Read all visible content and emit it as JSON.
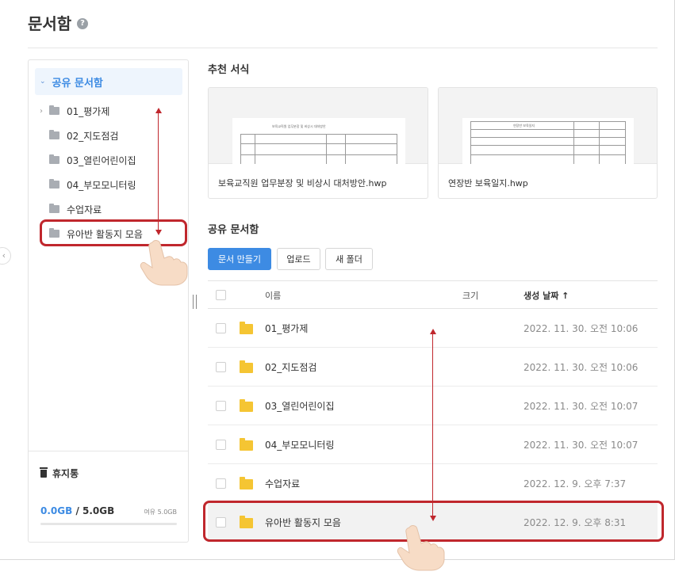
{
  "page": {
    "title": "문서함",
    "help_icon": "question-circle-icon"
  },
  "sidebar": {
    "root_label": "공유 문서함",
    "items": [
      {
        "label": "01_평가제",
        "has_children": true
      },
      {
        "label": "02_지도점검",
        "has_children": false
      },
      {
        "label": "03_열린어린이집",
        "has_children": false
      },
      {
        "label": "04_부모모니터링",
        "has_children": false
      },
      {
        "label": "수업자료",
        "has_children": false
      },
      {
        "label": "유아반 활동지 모음",
        "has_children": false
      }
    ],
    "trash_label": "휴지통",
    "quota_used": "0.0GB",
    "quota_total": " / 5.0GB",
    "quota_free": "여유 5.0GB",
    "quota_fraction": 0.0
  },
  "templates": {
    "section_title": "추천 서식",
    "cards": [
      {
        "name": "보육교직원 업무분장 및 비상시 대처방안.hwp",
        "preview_heading": "보육교직원 업무분장 및 비상시 대처방안"
      },
      {
        "name": "연장반 보육일지.hwp",
        "preview_heading": "연장반 보육일지"
      }
    ]
  },
  "shared": {
    "section_title": "공유 문서함",
    "buttons": {
      "create": "문서 만들기",
      "upload": "업로드",
      "new_folder": "새 폴더"
    },
    "columns": {
      "name": "이름",
      "size": "크기",
      "created": "생성 날짜 ↑"
    },
    "rows": [
      {
        "name": "01_평가제",
        "size": "",
        "created": "2022. 11. 30. 오전 10:06"
      },
      {
        "name": "02_지도점검",
        "size": "",
        "created": "2022. 11. 30. 오전 10:06"
      },
      {
        "name": "03_열린어린이집",
        "size": "",
        "created": "2022. 11. 30. 오전 10:07"
      },
      {
        "name": "04_부모모니터링",
        "size": "",
        "created": "2022. 11. 30. 오전 10:07"
      },
      {
        "name": "수업자료",
        "size": "",
        "created": "2022. 12. 9. 오후 7:37"
      },
      {
        "name": "유아반 활동지 모음",
        "size": "",
        "created": "2022. 12. 9. 오후 8:31"
      }
    ]
  },
  "colors": {
    "accent": "#3d8be3",
    "highlight": "#c0272d",
    "folder": "#f5c533"
  }
}
